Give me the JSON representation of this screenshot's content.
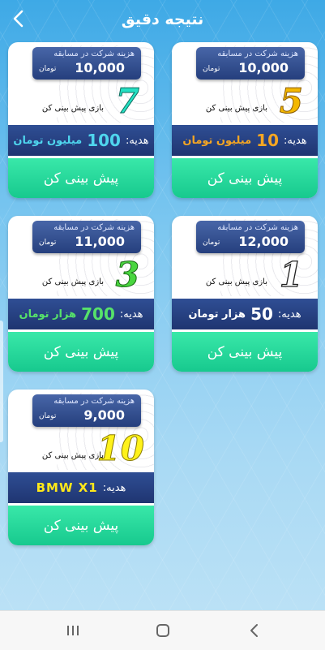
{
  "header": {
    "title": "نتیجه دقیق"
  },
  "labels": {
    "fee_label": "هزینه شرکت در مسابقه",
    "fee_unit": "تومان",
    "game_label": "بازی پیش بینی کن",
    "prize_label": "هدیه:",
    "action_label": "پیش بینی کن"
  },
  "cards": [
    {
      "fee_amount": "10,000",
      "game_count": "5",
      "prize_amount": "10",
      "prize_unit": "میلیون تومان",
      "prize_color": "#f5a623"
    },
    {
      "fee_amount": "10,000",
      "game_count": "7",
      "prize_amount": "100",
      "prize_unit": "میلیون تومان",
      "prize_color": "#4fd6ee"
    },
    {
      "fee_amount": "12,000",
      "game_count": "1",
      "prize_amount": "50",
      "prize_unit": "هزار تومان",
      "prize_color": "#ffffff"
    },
    {
      "fee_amount": "11,000",
      "game_count": "3",
      "prize_amount": "700",
      "prize_unit": "هزار تومان",
      "prize_color": "#56e26a"
    },
    {
      "fee_amount": "9,000",
      "game_count": "10",
      "prize_amount": "BMW X1",
      "prize_unit": "",
      "prize_color": "#ffe81a"
    }
  ],
  "icons": {
    "back": "chevron-left-icon",
    "recents": "recent-apps-icon",
    "home": "home-icon",
    "nav_back": "back-icon"
  }
}
